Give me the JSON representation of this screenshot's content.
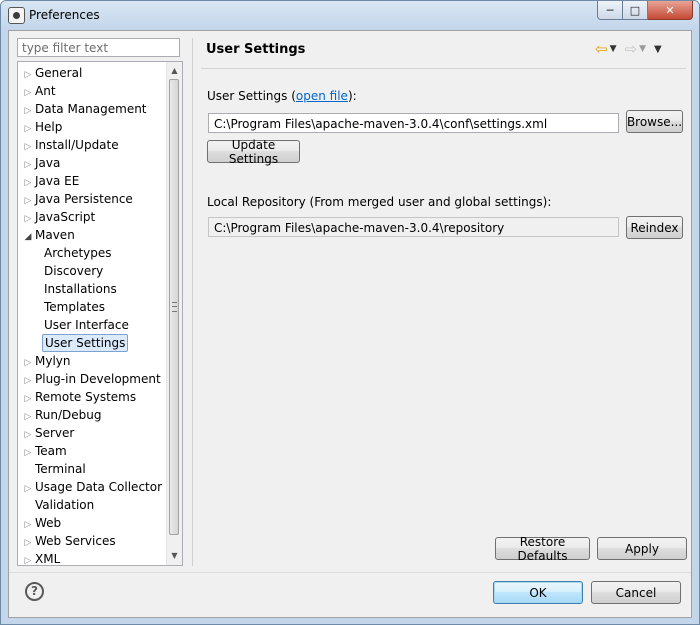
{
  "window": {
    "title": "Preferences"
  },
  "filter": {
    "placeholder": "type filter text"
  },
  "tree": [
    {
      "label": "General",
      "level": 0,
      "expander": "collapsed"
    },
    {
      "label": "Ant",
      "level": 0,
      "expander": "collapsed"
    },
    {
      "label": "Data Management",
      "level": 0,
      "expander": "collapsed"
    },
    {
      "label": "Help",
      "level": 0,
      "expander": "collapsed"
    },
    {
      "label": "Install/Update",
      "level": 0,
      "expander": "collapsed"
    },
    {
      "label": "Java",
      "level": 0,
      "expander": "collapsed"
    },
    {
      "label": "Java EE",
      "level": 0,
      "expander": "collapsed"
    },
    {
      "label": "Java Persistence",
      "level": 0,
      "expander": "collapsed"
    },
    {
      "label": "JavaScript",
      "level": 0,
      "expander": "collapsed"
    },
    {
      "label": "Maven",
      "level": 0,
      "expander": "expanded"
    },
    {
      "label": "Archetypes",
      "level": 1,
      "expander": "none"
    },
    {
      "label": "Discovery",
      "level": 1,
      "expander": "none"
    },
    {
      "label": "Installations",
      "level": 1,
      "expander": "none"
    },
    {
      "label": "Templates",
      "level": 1,
      "expander": "none"
    },
    {
      "label": "User Interface",
      "level": 1,
      "expander": "none"
    },
    {
      "label": "User Settings",
      "level": 1,
      "expander": "none",
      "selected": true
    },
    {
      "label": "Mylyn",
      "level": 0,
      "expander": "collapsed"
    },
    {
      "label": "Plug-in Development",
      "level": 0,
      "expander": "collapsed"
    },
    {
      "label": "Remote Systems",
      "level": 0,
      "expander": "collapsed"
    },
    {
      "label": "Run/Debug",
      "level": 0,
      "expander": "collapsed"
    },
    {
      "label": "Server",
      "level": 0,
      "expander": "collapsed"
    },
    {
      "label": "Team",
      "level": 0,
      "expander": "collapsed"
    },
    {
      "label": "Terminal",
      "level": 0,
      "expander": "none"
    },
    {
      "label": "Usage Data Collector",
      "level": 0,
      "expander": "collapsed"
    },
    {
      "label": "Validation",
      "level": 0,
      "expander": "none"
    },
    {
      "label": "Web",
      "level": 0,
      "expander": "collapsed"
    },
    {
      "label": "Web Services",
      "level": 0,
      "expander": "collapsed"
    },
    {
      "label": "XML",
      "level": 0,
      "expander": "collapsed"
    }
  ],
  "page": {
    "title": "User Settings",
    "user_settings_label": "User Settings (",
    "open_file_link": "open file",
    "user_settings_label_end": "):",
    "user_settings_path": "C:\\Program Files\\apache-maven-3.0.4\\conf\\settings.xml",
    "browse_button": "Browse...",
    "update_button": "Update Settings",
    "local_repo_label": "Local Repository (From merged user and global settings):",
    "local_repo_path": "C:\\Program Files\\apache-maven-3.0.4\\repository",
    "reindex_button": "Reindex",
    "restore_defaults_button": "Restore Defaults",
    "apply_button": "Apply"
  },
  "footer": {
    "ok_button": "OK",
    "cancel_button": "Cancel"
  },
  "colors": {
    "selection_bg": "#dcebfc",
    "link": "#0066cc",
    "back_arrow": "#e2a20e",
    "close_button": "#c44a33"
  }
}
